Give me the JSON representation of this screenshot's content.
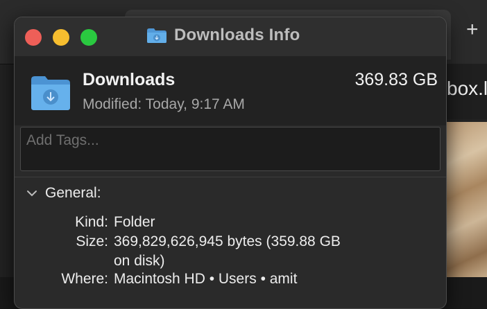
{
  "background": {
    "new_tab_symbol": "+",
    "partial_tab_text": "box.l"
  },
  "window": {
    "title": "Downloads Info",
    "title_icon": "folder-download-icon"
  },
  "header": {
    "name": "Downloads",
    "size": "369.83 GB",
    "modified": "Modified:  Today, 9:17 AM",
    "icon": "folder-download-icon"
  },
  "tags": {
    "placeholder": "Add Tags..."
  },
  "general": {
    "label": "General:",
    "rows": [
      {
        "key": "Kind:",
        "value": "Folder"
      },
      {
        "key": "Size:",
        "value": "369,829,626,945 bytes (359.88 GB",
        "value2": "on disk)"
      },
      {
        "key": "Where:",
        "value": "Macintosh HD • Users • amit"
      }
    ]
  },
  "colors": {
    "folder_blue": "#5ea8e6",
    "close": "#ee5f58",
    "minimize": "#f7be2f",
    "zoom": "#2ac940"
  }
}
